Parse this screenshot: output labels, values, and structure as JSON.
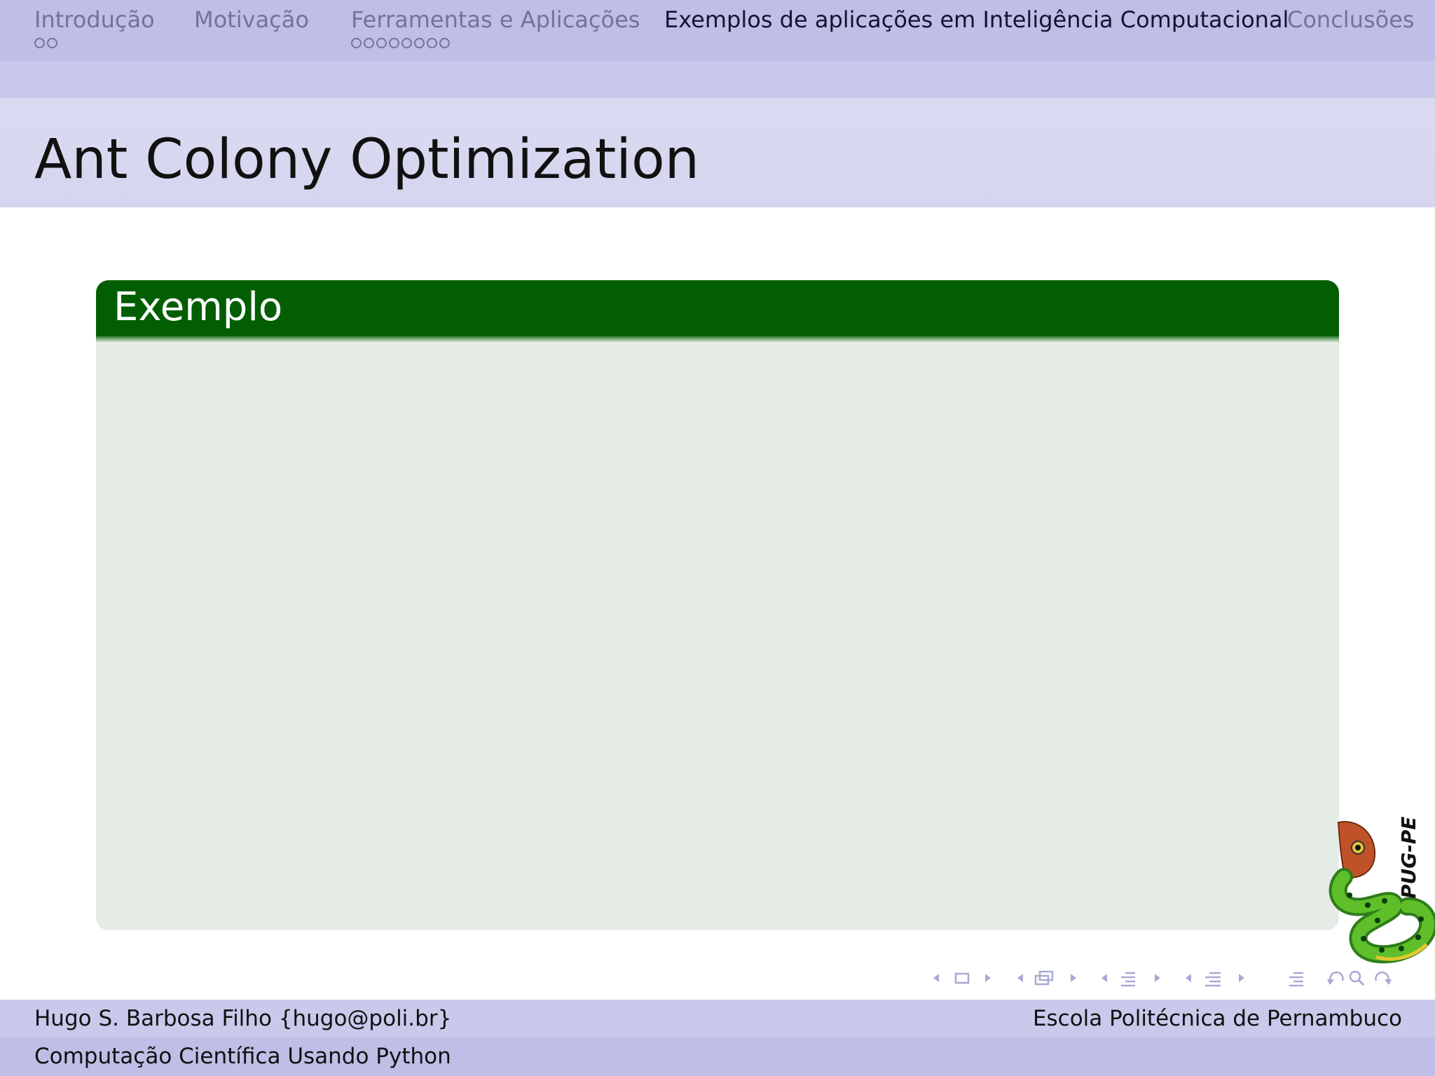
{
  "nav": {
    "sections": [
      {
        "label": "Introdução",
        "dots": 2,
        "active": false
      },
      {
        "label": "Motivação",
        "dots": 0,
        "active": false
      },
      {
        "label": "Ferramentas e Aplicações",
        "dots": 8,
        "active": false
      },
      {
        "label": "Exemplos de aplicações em Inteligência Computacional",
        "dots": 0,
        "active": true
      },
      {
        "label": "Conclusões",
        "dots": 0,
        "active": false
      }
    ]
  },
  "frame": {
    "title": "Ant Colony Optimization"
  },
  "block": {
    "title": "Exemplo"
  },
  "logo": {
    "text": "PUG-PE"
  },
  "nav_symbols": [
    "slide-prev-icon",
    "slide-icon",
    "slide-next-icon",
    "frame-prev-icon",
    "frame-icon",
    "frame-next-icon",
    "subsection-prev-icon",
    "subsection-icon",
    "subsection-next-icon",
    "section-prev-icon",
    "section-icon",
    "section-next-icon",
    "document-icon",
    "back-icon",
    "search-icon",
    "forward-icon"
  ],
  "footer": {
    "author": "Hugo S. Barbosa Filho {hugo@poli.br}",
    "institution": "Escola Politécnica de Pernambuco",
    "course": "Computação Científica Usando Python"
  },
  "colors": {
    "nav_bg": "#bebee6",
    "nav_bg_light": "#c9c9ec",
    "title_bg": "#d8d8f0",
    "block_header": "#035e03",
    "block_body": "#e5ece5",
    "nav_inactive_text": "#7272a0"
  }
}
